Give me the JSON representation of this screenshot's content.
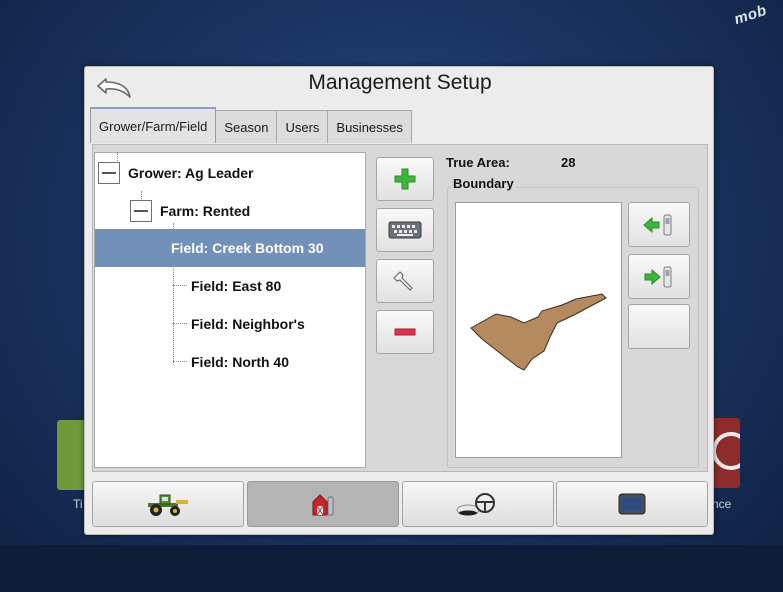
{
  "background": {
    "gps_badge": "mob",
    "left_tile_label": "Ti",
    "right_tile_label": "nce"
  },
  "dialog": {
    "title": "Management Setup",
    "back_icon": "back-arrow-icon"
  },
  "tabs": [
    {
      "label": "Grower/Farm/Field",
      "active": true
    },
    {
      "label": "Season",
      "active": false
    },
    {
      "label": "Users",
      "active": false
    },
    {
      "label": "Businesses",
      "active": false
    }
  ],
  "tree": {
    "grower": "Grower: Ag Leader",
    "farm": "Farm: Rented",
    "fields": [
      "Field: Creek Bottom 30",
      "Field: East 80",
      "Field: Neighbor's",
      "Field: North 40"
    ],
    "selected_index": 0
  },
  "side_buttons": [
    {
      "name": "add-button",
      "icon": "plus-icon"
    },
    {
      "name": "rename-button",
      "icon": "keyboard-icon"
    },
    {
      "name": "edit-button",
      "icon": "wrench-icon"
    },
    {
      "name": "remove-button",
      "icon": "minus-icon"
    }
  ],
  "details": {
    "true_area_label": "True Area:",
    "true_area_value": "28",
    "boundary_label": "Boundary"
  },
  "map_buttons": [
    {
      "name": "import-boundary-button",
      "icon": "import-boundary-icon"
    },
    {
      "name": "export-boundary-button",
      "icon": "export-boundary-icon"
    },
    {
      "name": "blank-button",
      "icon": ""
    }
  ],
  "nav_buttons": [
    {
      "name": "nav-tractor-button",
      "icon": "tractor-icon",
      "active": false
    },
    {
      "name": "nav-barn-button",
      "icon": "barn-icon",
      "active": true
    },
    {
      "name": "nav-steering-button",
      "icon": "steering-wheel-icon",
      "active": false
    },
    {
      "name": "nav-display-button",
      "icon": "display-icon",
      "active": false
    }
  ],
  "colors": {
    "selected_row": "#7390b8",
    "boundary_fill": "#b48a5e",
    "add_green": "#3db53d",
    "remove_red": "#d8344a"
  }
}
